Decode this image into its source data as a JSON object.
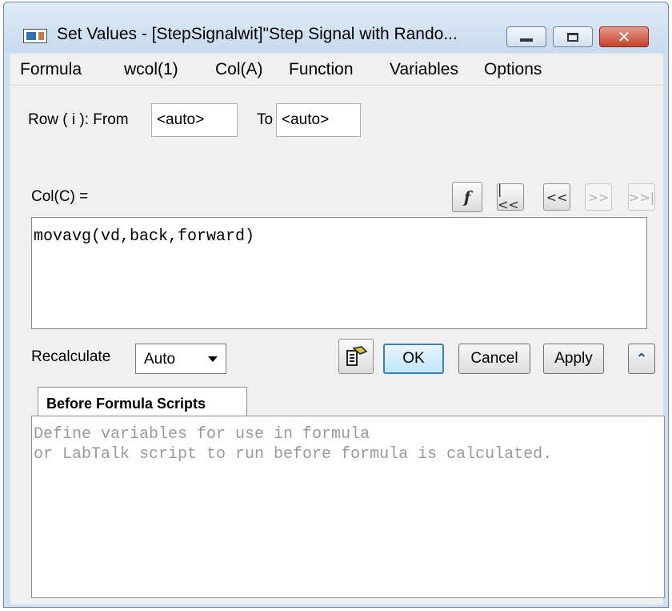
{
  "window": {
    "title": "Set Values - [StepSignalwit]\"Step Signal with Rando...",
    "min_glyph": "",
    "max_glyph": "",
    "close_glyph": "✕"
  },
  "menu": [
    "Formula",
    "wcol(1)",
    "Col(A)",
    "Function",
    "Variables",
    "Options"
  ],
  "row": {
    "label": "Row ( i ):  From",
    "from_value": "<auto>",
    "to_label": "To",
    "to_value": "<auto>"
  },
  "col_label": "Col(C) =",
  "nav": {
    "fx": "f",
    "first": "|<<",
    "prev": "<<",
    "next": ">>",
    "last": ">>|"
  },
  "formula": "movavg(vd,back,forward)",
  "recalculate": {
    "label": "Recalculate",
    "value": "Auto"
  },
  "buttons": {
    "ok": "OK",
    "cancel": "Cancel",
    "apply": "Apply",
    "collapse": "⌃"
  },
  "tab": {
    "label": "Before Formula Scripts"
  },
  "script_placeholder": "Define variables for use in formula\nor LabTalk script to run before formula is calculated."
}
